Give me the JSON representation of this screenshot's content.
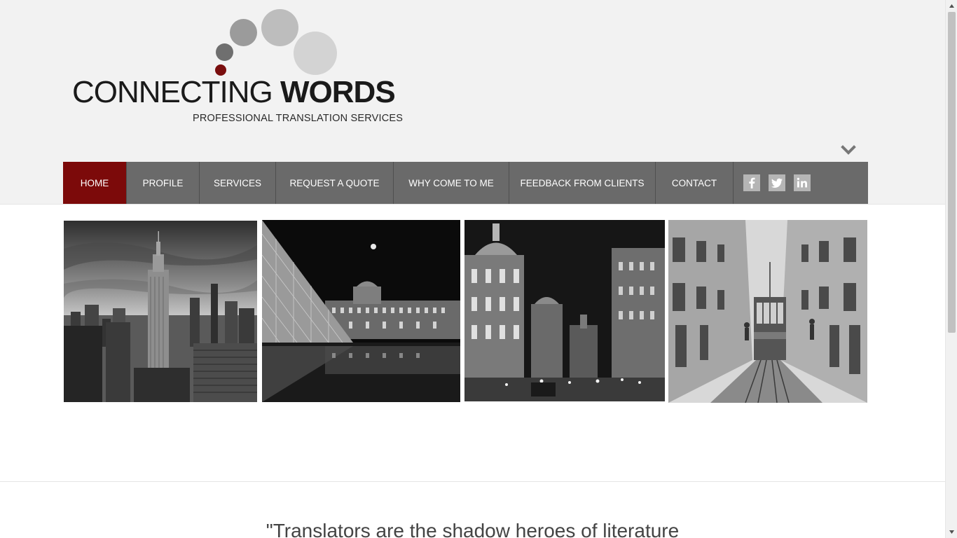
{
  "logo": {
    "title_light": "CONNECTING",
    "title_bold": "WORDS",
    "subtitle": "PROFESSIONAL TRANSLATION SERVICES"
  },
  "nav": {
    "items": [
      {
        "label": "HOME",
        "active": true
      },
      {
        "label": "PROFILE",
        "active": false
      },
      {
        "label": "SERVICES",
        "active": false
      },
      {
        "label": "REQUEST A QUOTE",
        "active": false
      },
      {
        "label": "WHY COME TO ME",
        "active": false
      },
      {
        "label": "FEEDBACK FROM CLIENTS",
        "active": false
      },
      {
        "label": "CONTACT",
        "active": false
      }
    ],
    "social": [
      "facebook-icon",
      "twitter-icon",
      "linkedin-icon"
    ]
  },
  "colors": {
    "accent": "#7c0a0a",
    "nav_bg": "#6a6a6a",
    "header_bg": "#f2f2f2"
  },
  "quote": {
    "text": "\"Translators are the shadow heroes of literature"
  }
}
